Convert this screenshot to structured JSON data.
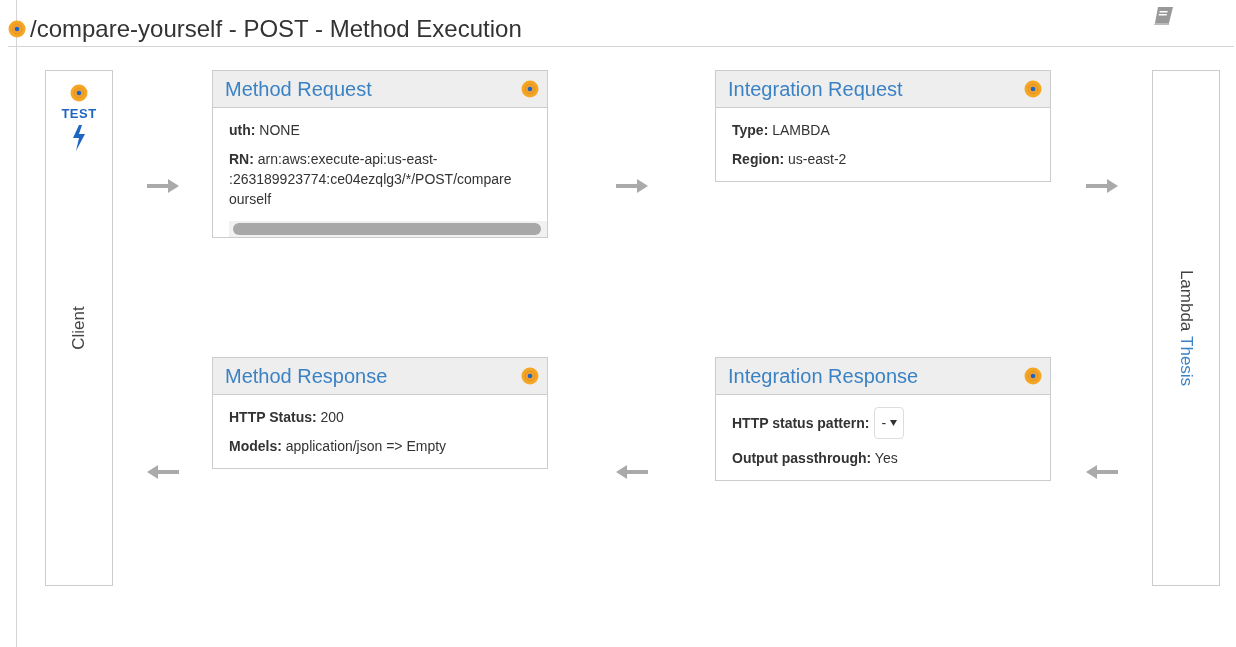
{
  "page": {
    "title": "/compare-yourself - POST - Method Execution"
  },
  "client": {
    "test_label": "TEST",
    "label": "Client"
  },
  "backend": {
    "label": "Lambda",
    "link": "Thesis"
  },
  "cards": [
    {
      "title": "Method Request",
      "scrollbar": true,
      "fields": [
        {
          "kind": "text",
          "label": "uth:",
          "lines": [
            "NONE"
          ]
        },
        {
          "kind": "text",
          "label": "RN:",
          "lines": [
            "arn:aws:execute-api:us-east-",
            ":263189923774:ce04ezqlg3/*/POST/compare",
            "ourself"
          ]
        }
      ]
    },
    {
      "title": "Integration Request",
      "scrollbar": false,
      "fields": [
        {
          "kind": "text",
          "label": "Type:",
          "lines": [
            "LAMBDA"
          ]
        },
        {
          "kind": "text",
          "label": "Region:",
          "lines": [
            "us-east-2"
          ]
        }
      ]
    },
    {
      "title": "Method Response",
      "scrollbar": false,
      "fields": [
        {
          "kind": "text",
          "label": "HTTP Status:",
          "lines": [
            "200"
          ]
        },
        {
          "kind": "text",
          "label": "Models:",
          "lines": [
            "application/json => Empty"
          ]
        }
      ]
    },
    {
      "title": "Integration Response",
      "scrollbar": false,
      "fields": [
        {
          "kind": "select",
          "label": "HTTP status pattern:",
          "lines": [
            "-"
          ]
        },
        {
          "kind": "text",
          "label": "Output passthrough:",
          "lines": [
            "Yes"
          ]
        }
      ]
    }
  ]
}
